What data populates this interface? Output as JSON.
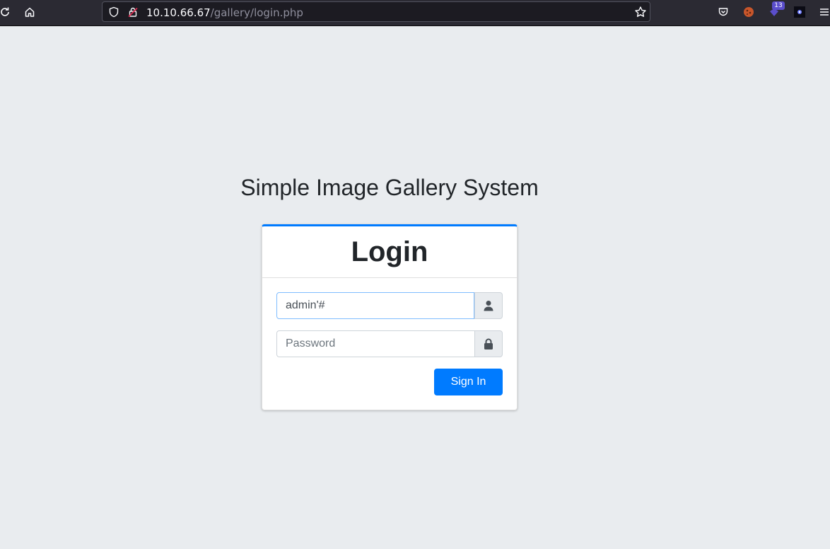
{
  "browser": {
    "url_host": "10.10.66.67",
    "url_path": "/gallery/login.php",
    "extension_badge_count": "13"
  },
  "page": {
    "app_title": "Simple Image Gallery System"
  },
  "login_card": {
    "title": "Login",
    "username_value": "admin'#",
    "password_placeholder": "Password",
    "sign_in_label": "Sign In"
  },
  "colors": {
    "primary": "#007bff",
    "background": "#e9ecef",
    "toolbar": "#2b2a33"
  }
}
